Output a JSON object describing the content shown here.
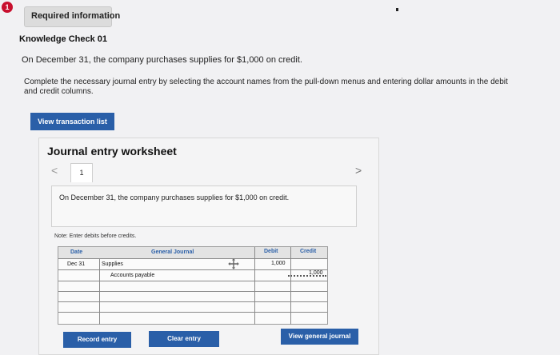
{
  "header": {
    "badge": "1",
    "required_label": "Required information"
  },
  "knowledge_check": {
    "title": "Knowledge Check 01",
    "prompt": "On December 31, the company purchases supplies for $1,000 on credit.",
    "instructions": "Complete the necessary journal entry by selecting the account names from the pull-down menus and entering dollar amounts in the debit and credit columns."
  },
  "buttons": {
    "view_transaction_list": "View transaction list",
    "record_entry": "Record entry",
    "clear_entry": "Clear entry",
    "view_general_journal": "View general journal"
  },
  "worksheet": {
    "title": "Journal entry worksheet",
    "nav_prev": "<",
    "nav_next": ">",
    "tab_label": "1",
    "transaction_text": "On December 31, the company purchases supplies for $1,000 on credit.",
    "note": "Note: Enter debits before credits."
  },
  "journal": {
    "headers": {
      "date": "Date",
      "general_journal": "General Journal",
      "debit": "Debit",
      "credit": "Credit"
    },
    "rows": [
      {
        "date": "Dec 31",
        "account": "Supplies",
        "debit": "1,000",
        "credit": ""
      },
      {
        "date": "",
        "account": "Accounts payable",
        "debit": "",
        "credit": "1,000"
      },
      {
        "date": "",
        "account": "",
        "debit": "",
        "credit": ""
      },
      {
        "date": "",
        "account": "",
        "debit": "",
        "credit": ""
      },
      {
        "date": "",
        "account": "",
        "debit": "",
        "credit": ""
      },
      {
        "date": "",
        "account": "",
        "debit": "",
        "credit": ""
      }
    ]
  },
  "colors": {
    "button_blue": "#2a5fa8",
    "badge_red": "#c8102e",
    "header_text_blue": "#2a5fa8"
  },
  "icons": {
    "badge": "info-badge",
    "move": "move-icon"
  }
}
